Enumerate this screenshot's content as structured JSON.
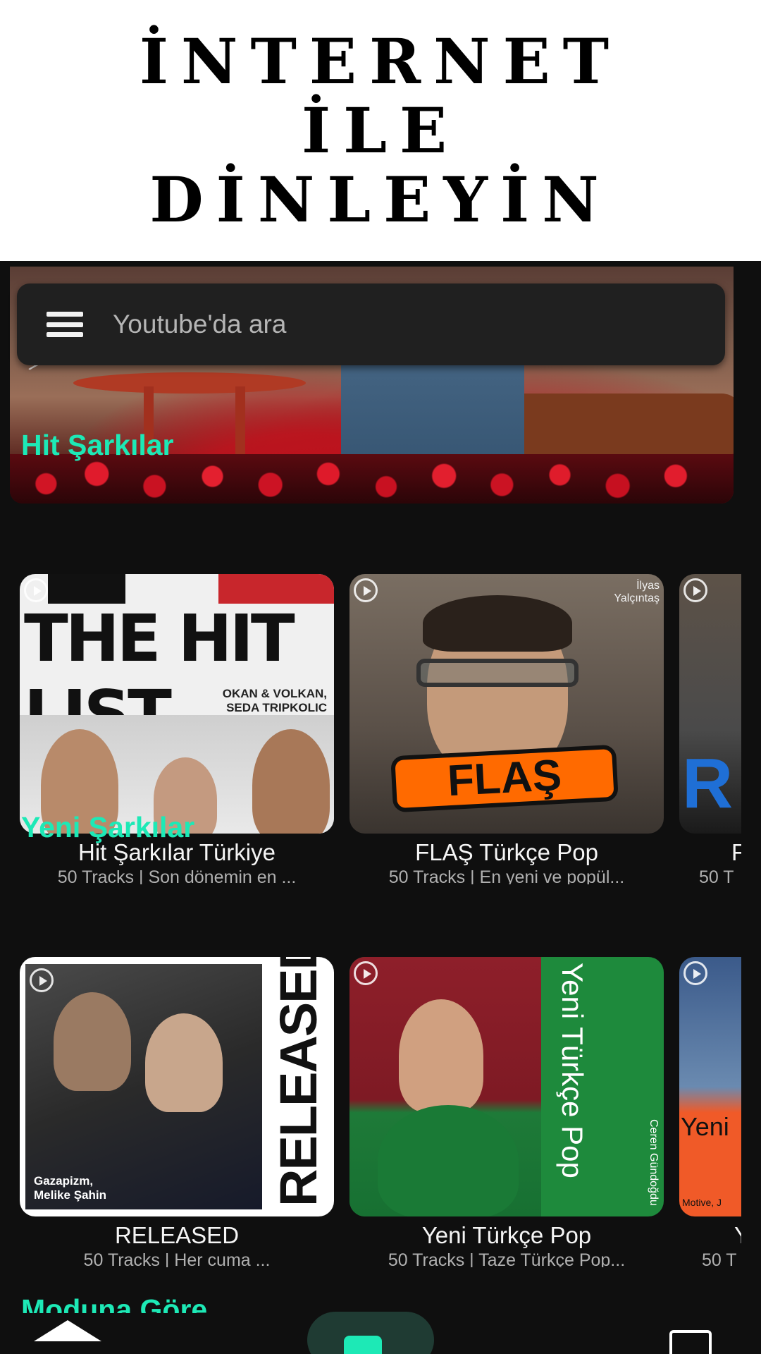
{
  "promo": {
    "lines": [
      "İNTERNET",
      "İLE",
      "DİNLEYİN"
    ]
  },
  "search": {
    "placeholder": "Youtube'da ara"
  },
  "sections": [
    {
      "title": "Hit Şarkılar",
      "cards": [
        {
          "title": "Hit Şarkılar Türkiye",
          "subtitle": "50 Tracks | Son dönemin en ...",
          "cover_text": "THE HIT LIST",
          "cover_names": "OKAN & VOLKAN,\nSEDA TRIPKOLIC"
        },
        {
          "title": "FLAŞ Türkçe Pop",
          "subtitle": "50 Tracks | En yeni ve popül...",
          "cover_text": "FLAŞ",
          "cover_artist": "İlyas\nYalçıntaş"
        },
        {
          "title": "F",
          "subtitle": "50 T",
          "cover_text": "R"
        }
      ]
    },
    {
      "title": "Yeni Şarkılar",
      "cards": [
        {
          "title": "RELEASED",
          "subtitle": "50 Tracks | Her cuma ...",
          "cover_text": "RELEASED",
          "cover_names": "Gazapizm,\nMelike Şahin"
        },
        {
          "title": "Yeni Türkçe Pop",
          "subtitle": "50 Tracks | Taze Türkçe Pop...",
          "cover_text": "Yeni Türkçe Pop",
          "cover_artist": "Ceren Gündoğdu"
        },
        {
          "title": "Y",
          "subtitle": "50 T",
          "cover_text": "Yeni",
          "cover_artist": "Motive, J"
        }
      ]
    },
    {
      "title": "Moduna Göre"
    }
  ],
  "colors": {
    "accent": "#1de9b6",
    "background": "#0f0f0f",
    "search_bg": "#202020"
  },
  "icons": {
    "menu": "hamburger-menu-icon",
    "home": "home-icon",
    "play": "play-tab-icon",
    "radio": "radio-icon"
  }
}
